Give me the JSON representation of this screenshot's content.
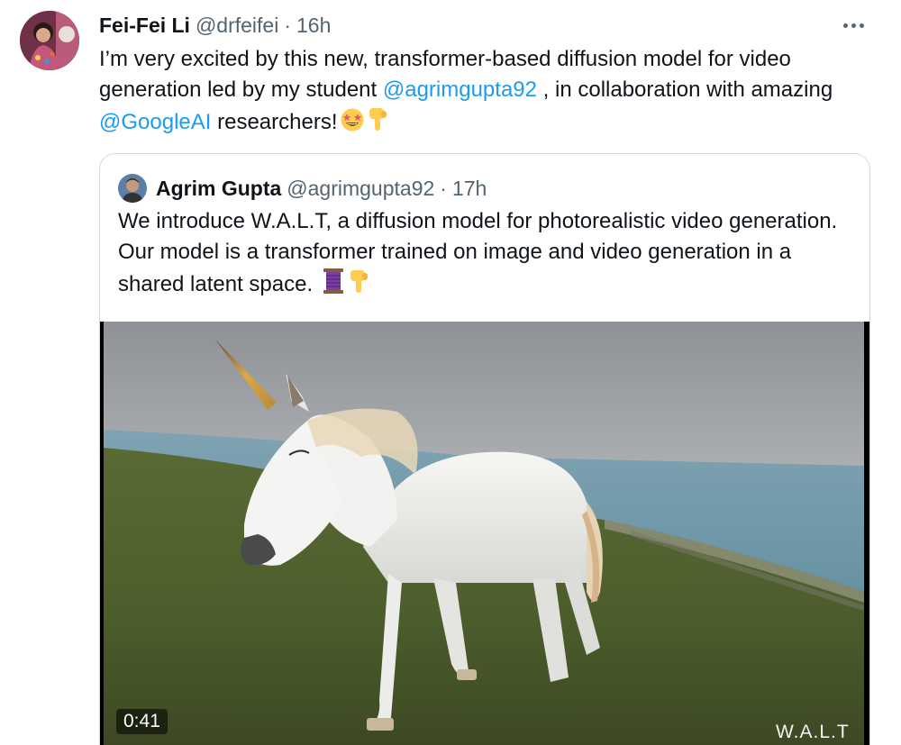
{
  "tweet": {
    "author_name": "Fei-Fei Li",
    "author_handle": "@drfeifei",
    "separator": "·",
    "time": "16h",
    "text_part1": "I’m very excited by this new, transformer-based diffusion model for video generation led by my student ",
    "mention1": "@agrimgupta92",
    "text_part2": " , in collaboration with amazing ",
    "mention2": "@GoogleAI",
    "text_part3": " researchers!",
    "emojis": [
      "star-struck-emoji",
      "pointing-down-emoji"
    ]
  },
  "quote": {
    "author_name": "Agrim Gupta",
    "author_handle": "@agrimgupta92",
    "separator": "·",
    "time": "17h",
    "text": "We introduce W.A.L.T, a diffusion model for photorealistic video generation. Our model is a transformer trained on image and video generation in a shared latent space.",
    "emojis": [
      "thread-spool-emoji",
      "pointing-down-emoji"
    ],
    "video": {
      "duration": "0:41",
      "watermark": "W.A.L.T",
      "subject": "white unicorn on grassy coastline"
    }
  },
  "colors": {
    "text": "#0f1419",
    "secondary": "#536471",
    "link": "#1d9bf0",
    "border": "#cfd9de"
  }
}
